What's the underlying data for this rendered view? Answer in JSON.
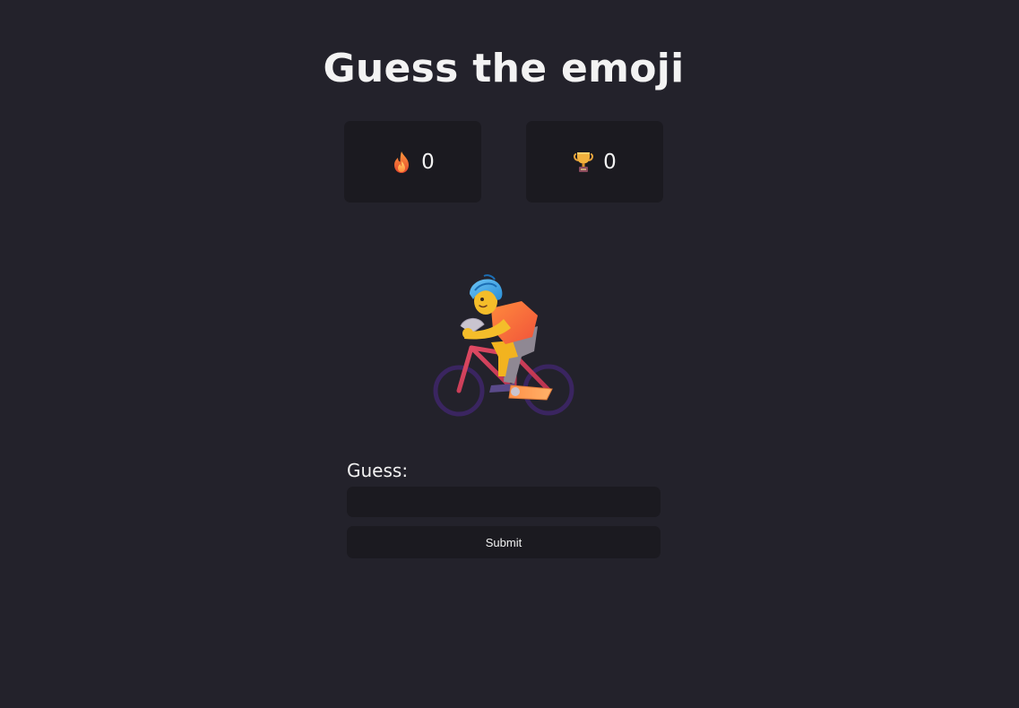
{
  "header": {
    "title": "Guess the emoji"
  },
  "stats": {
    "streak": {
      "icon": "fire-icon",
      "value": "0"
    },
    "best": {
      "icon": "trophy-icon",
      "value": "0"
    }
  },
  "puzzle": {
    "emoji": "person-biking-emoji"
  },
  "form": {
    "label": "Guess:",
    "input_value": "",
    "input_placeholder": "",
    "submit_label": "Submit"
  },
  "colors": {
    "background": "#23222b",
    "card": "#1b1a20",
    "text": "#f2f2f2"
  }
}
